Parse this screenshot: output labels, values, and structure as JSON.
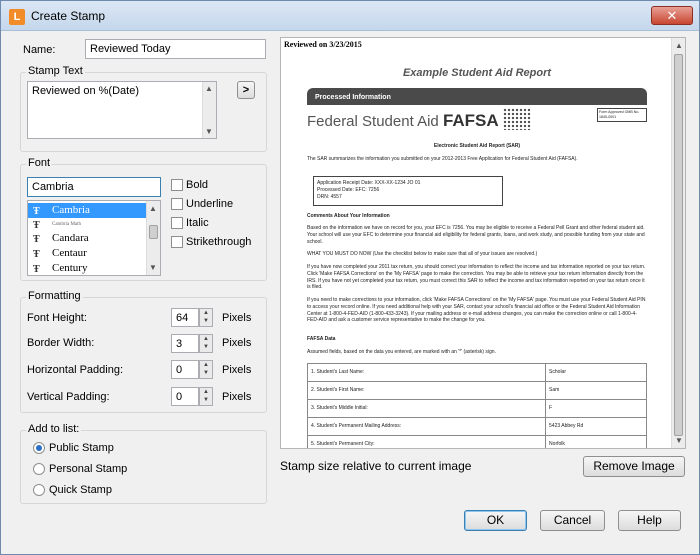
{
  "window": {
    "title": "Create Stamp",
    "app_icon_letter": "L",
    "close_symbol": "✕"
  },
  "name_field": {
    "label": "Name:",
    "value": "Reviewed Today"
  },
  "stamp_text": {
    "section_label": "Stamp Text",
    "value": "Reviewed on %(Date)",
    "insert_button": ">"
  },
  "font": {
    "section_label": "Font",
    "value": "Cambria",
    "list": [
      {
        "name": "Cambria",
        "selected": true
      },
      {
        "name": "Cambria Math",
        "selected": false
      },
      {
        "name": "Candara",
        "selected": false
      },
      {
        "name": "Centaur",
        "selected": false
      },
      {
        "name": "Century",
        "selected": false
      }
    ],
    "styles": [
      "Bold",
      "Underline",
      "Italic",
      "Strikethrough"
    ]
  },
  "formatting": {
    "section_label": "Formatting",
    "fields": [
      {
        "label": "Font Height:",
        "value": "64",
        "unit": "Pixels"
      },
      {
        "label": "Border Width:",
        "value": "3",
        "unit": "Pixels"
      },
      {
        "label": "Horizontal Padding:",
        "value": "0",
        "unit": "Pixels"
      },
      {
        "label": "Vertical Padding:",
        "value": "0",
        "unit": "Pixels"
      }
    ]
  },
  "add_to_list": {
    "section_label": "Add to list:",
    "options": [
      {
        "label": "Public Stamp",
        "checked": true
      },
      {
        "label": "Personal Stamp",
        "checked": false
      },
      {
        "label": "Quick Stamp",
        "checked": false
      }
    ]
  },
  "preview": {
    "stamp_text": "Reviewed on 3/23/2015",
    "doc_title": "Example Student Aid Report",
    "banner": "Processed Information",
    "logo_prefix": "Federal Student Aid",
    "logo_main": "FAFSA",
    "approved": "Form Approved OMB No. 1845-0001",
    "sar_heading": "Electronic Student Aid Report (SAR)",
    "intro": "The SAR summarizes the information you submitted on your 2012-2013 Free Application for Federal Student Aid (FAFSA).",
    "box_lines": [
      "Application Receipt Date:        XXX-XX-1234 JO 01",
      "Processed Date:                        EFC: 7256",
      "                                                  DRN: 4557"
    ],
    "comments_heading": "Comments About Your Information",
    "paragraphs": [
      "Based on the information we have on record for you, your EFC is 7256. You may be eligible to receive a Federal Pell Grant and other federal student aid. Your school will use your EFC to determine your financial aid eligibility for federal grants, loans, and work study, and possible funding from your state and school.",
      "WHAT YOU MUST DO NOW (Use the checklist below to make sure that all of your issues are resolved.)",
      "If you have now completed your 2011 tax return, you should correct your information to reflect the income and tax information reported on your tax return. Click 'Make FAFSA Corrections' on the 'My FAFSA' page to make the correction. You may be able to retrieve your tax return information directly from the IRS. If you have not yet completed your tax return, you must correct this SAR to reflect the income and tax information reported on your tax return once it is filed.",
      "If you need to make corrections to your information, click 'Make FAFSA Corrections' on the 'My FAFSA' page. You must use your Federal Student Aid PIN to access your record online. If you need additional help with your SAR, contact your school's financial aid office or the Federal Student Aid Information Center at 1-800-4-FED-AID (1-800-433-3243). If your mailing address or e-mail address changes, you can make the correction online or call 1-800-4-FED-AID and ask a customer service representative to make the change for you."
    ],
    "fafsa_heading": "FAFSA Data",
    "fafsa_note": "Assumed fields, based on the data you entered, are marked with an '*' (asterisk) sign.",
    "table": [
      [
        "1. Student's Last Name:",
        "Scholar"
      ],
      [
        "2. Student's First Name:",
        "Sam"
      ],
      [
        "3. Student's Middle Initial:",
        "F"
      ],
      [
        "4. Student's Permanent Mailing Address:",
        "5423 Abbey Rd"
      ],
      [
        "5. Student's Permanent City:",
        "Norfolk"
      ]
    ]
  },
  "caption": "Stamp size relative to current image",
  "buttons": {
    "remove_image": "Remove Image",
    "ok": "OK",
    "cancel": "Cancel",
    "help": "Help"
  }
}
